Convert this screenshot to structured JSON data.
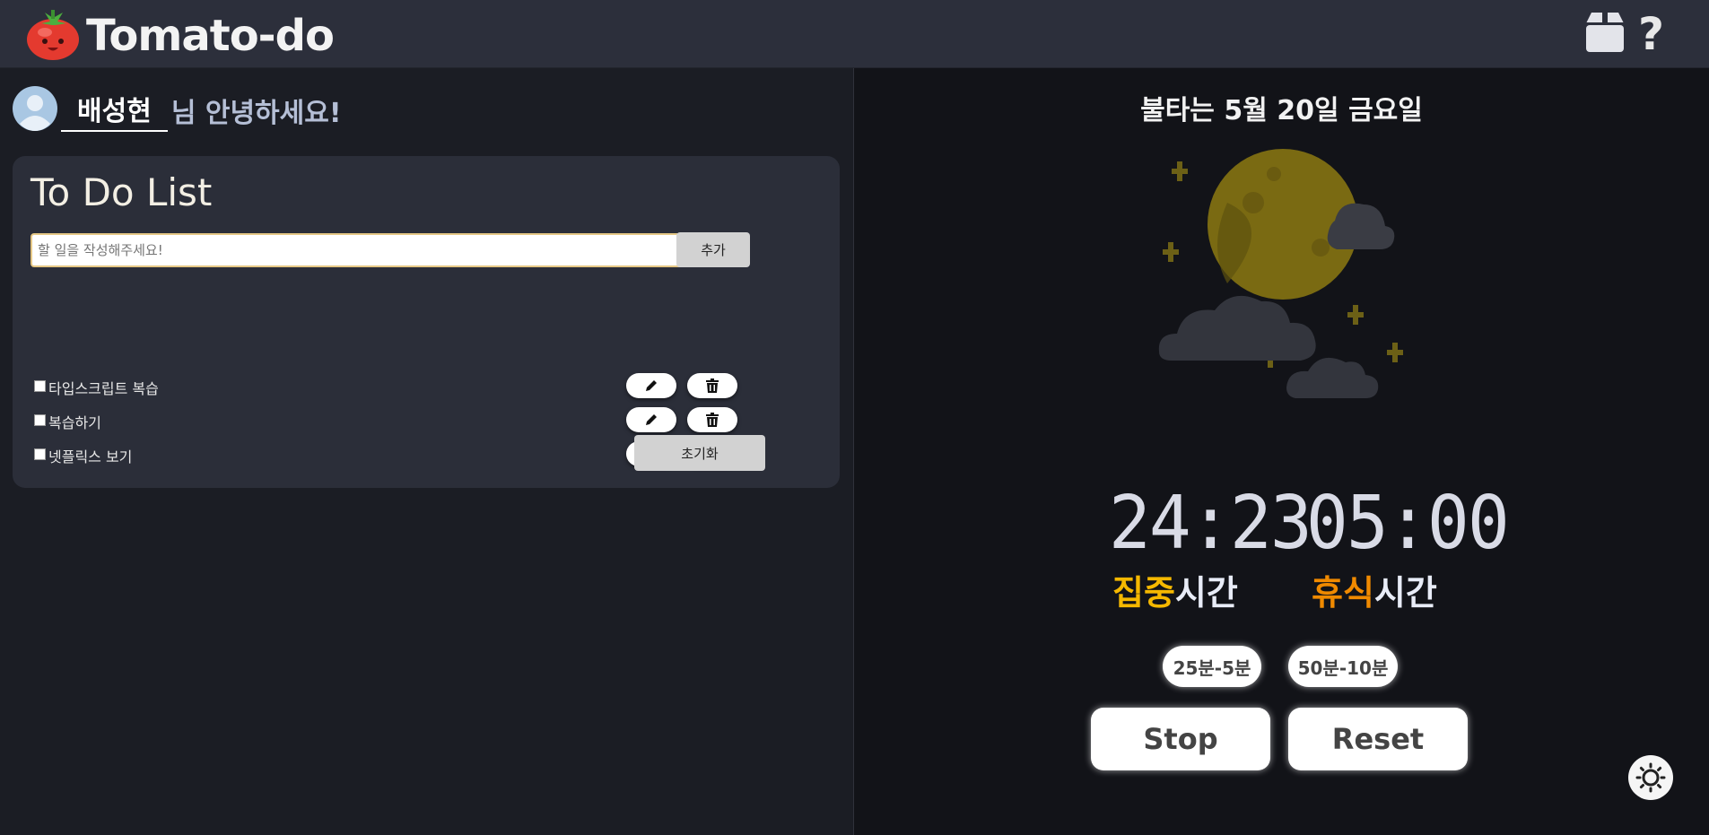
{
  "header": {
    "title": "Tomato-do",
    "logo_icon": "tomato-icon",
    "box_icon": "box-icon",
    "help_label": "?"
  },
  "greeting": {
    "username": "배성현",
    "text": "님 안녕하세요!"
  },
  "todo": {
    "title": "To Do List",
    "input_placeholder": "할 일을 작성해주세요!",
    "add_label": "추가",
    "items": [
      {
        "text": "타입스크립트 복습",
        "checked": false
      },
      {
        "text": "복습하기",
        "checked": false
      },
      {
        "text": "넷플릭스 보기",
        "checked": false
      }
    ],
    "reset_label": "초기화"
  },
  "timer": {
    "date": "불타는 5월 20일 금요일",
    "focus_time": "24:23",
    "break_time": "05:00",
    "focus_highlight": "집중",
    "focus_suffix": "시간",
    "break_highlight": "휴식",
    "break_suffix": "시간",
    "preset_1": "25분-5분",
    "preset_2": "50분-10분",
    "stop_label": "Stop",
    "reset_label": "Reset"
  },
  "colors": {
    "focus_accent": "#f5b800",
    "break_accent": "#f08a00"
  },
  "theme_toggle_icon": "sun-icon"
}
